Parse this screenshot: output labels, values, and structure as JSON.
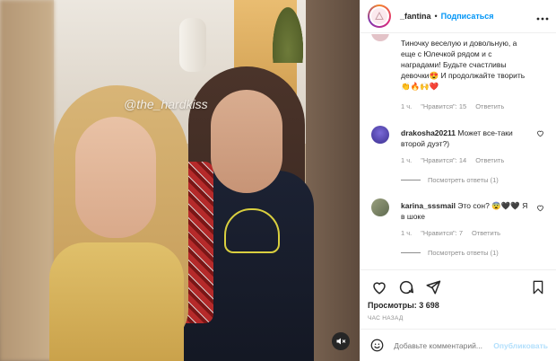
{
  "media": {
    "watermark": "@the_hardkiss",
    "mute_icon": "speaker-muted-icon"
  },
  "header": {
    "username": "_fantina",
    "separator": "•",
    "follow_label": "Подписаться",
    "more_icon": "more-horizontal-icon"
  },
  "comments": [
    {
      "username": "",
      "text": "Тиночку веселую и довольную, а еще с Юлечкой рядом и с наградами! Будьте счастливы девочки😍 И продолжайте творить👏🔥🙌❤️",
      "time": "1 ч.",
      "likes": "\"Нравится\": 15",
      "reply": "Ответить"
    },
    {
      "username": "drakosha20211",
      "text": "Может все-таки второй дуэт?)",
      "time": "1 ч.",
      "likes": "\"Нравится\": 14",
      "reply": "Ответить",
      "replies": "Посмотреть ответы (1)"
    },
    {
      "username": "karina_sssmail",
      "text": "Это сон? 😨🖤🖤 Я в шоке",
      "time": "1 ч.",
      "likes": "\"Нравится\": 7",
      "reply": "Ответить",
      "replies": "Посмотреть ответы (1)"
    }
  ],
  "actions": {
    "views": "Просмотры: 3 698",
    "time_ago": "ЧАС НАЗАД"
  },
  "add_comment": {
    "placeholder": "Добавьте комментарий...",
    "publish_label": "Опубликовать"
  },
  "colors": {
    "accent": "#0095f6",
    "publish_disabled": "#b2dffc",
    "muted_text": "#8e8e8e"
  }
}
